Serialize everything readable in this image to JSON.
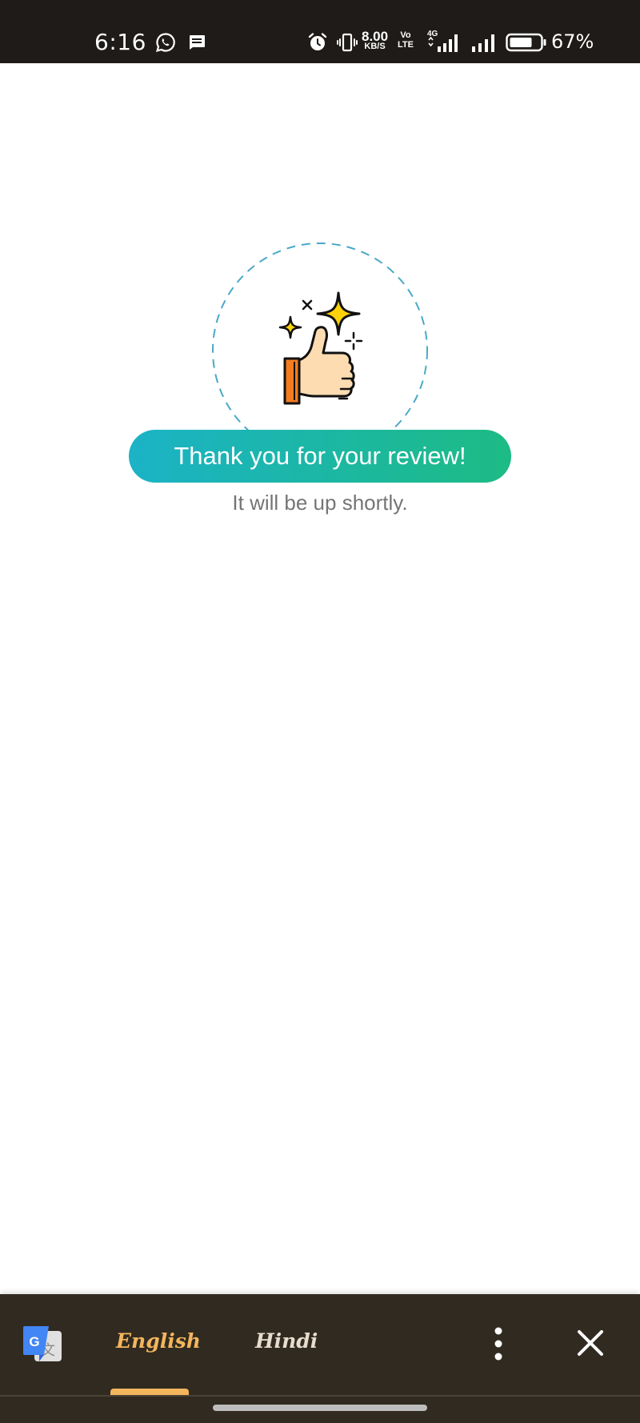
{
  "status_bar": {
    "time": "6:16",
    "net_speed_value": "8.00",
    "net_speed_unit": "KB/S",
    "volte_top": "Vo",
    "volte_bottom": "LTE",
    "network_type": "4G",
    "battery_percent": "67%",
    "icons": [
      "whatsapp-icon",
      "message-icon",
      "alarm-icon",
      "vibrate-icon",
      "signal-icon",
      "signal-icon",
      "battery-icon"
    ]
  },
  "main": {
    "graphic_icon": "thumbs-up-sparkles-icon",
    "title": "Thank you for your review!",
    "subtitle": "It will be up shortly."
  },
  "translate_bar": {
    "logo_icon": "google-translate-icon",
    "tabs": [
      {
        "label": "English",
        "selected": true
      },
      {
        "label": "Hindi",
        "selected": false
      }
    ],
    "more_icon": "more-vert-icon",
    "close_icon": "close-icon"
  },
  "colors": {
    "status_bar_bg": "#1e1b18",
    "pill_gradient_start": "#1bb3c6",
    "pill_gradient_end": "#1dbb84",
    "translate_bar_bg": "#312a20",
    "accent_selected_tab": "#f3b65d",
    "dashed_circle": "#4aa8c8"
  }
}
